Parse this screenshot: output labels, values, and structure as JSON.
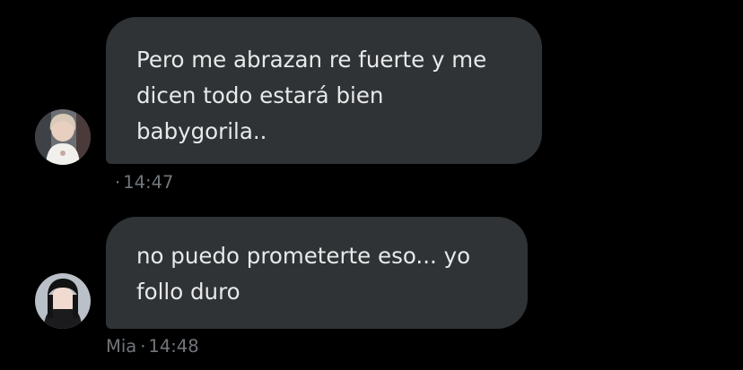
{
  "messages": [
    {
      "sender": "",
      "text": "Pero me abrazan re fuerte y me\ndicen todo estará bien\nbabygorila..",
      "time": "14:47"
    },
    {
      "sender": "Mia",
      "text": "no puedo prometerte eso... yo\nfollo duro",
      "time": "14:48"
    }
  ],
  "colors": {
    "background": "#000000",
    "bubble": "#2f3336",
    "text": "#e7e9ea",
    "meta": "#71767b"
  },
  "icons": {
    "message_1_avatar": "profile-photo-avatar",
    "message_2_avatar": "profile-photo-avatar"
  }
}
